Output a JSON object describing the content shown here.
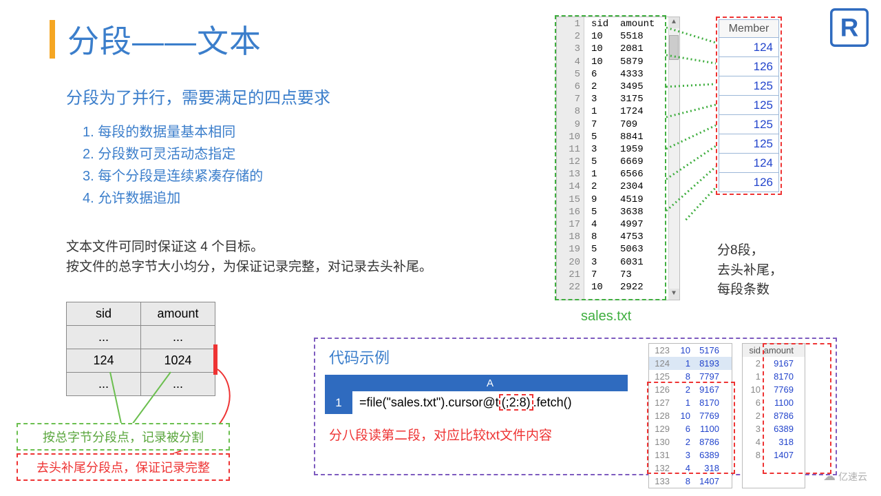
{
  "logo": {
    "letter": "R"
  },
  "watermark": "亿速云",
  "title": "分段——文本",
  "subtitle": "分段为了并行，需要满足的四点要求",
  "requirements": [
    "1. 每段的数据量基本相同",
    "2. 分段数可灵活动态指定",
    "3. 每个分段是连续紧凑存储的",
    "4. 允许数据追加"
  ],
  "body_lines": [
    "文本文件可同时保证这 4 个目标。",
    "按文件的总字节大小均分，为保证记录完整，对记录去头补尾。"
  ],
  "left_table": {
    "headers": [
      "sid",
      "amount"
    ],
    "rows": [
      [
        "...",
        "..."
      ],
      [
        "124",
        "1024"
      ],
      [
        "...",
        "..."
      ]
    ]
  },
  "green_note": "按总字节分段点，记录被分割",
  "red_note": "去头补尾分段点，保证记录完整",
  "code_panel": {
    "title": "代码示例",
    "col_header": "A",
    "row_num": "1",
    "code_prefix": "=file(\"sales.txt\").cursor@t",
    "code_boxed": "(;2:8)",
    "code_suffix": ".fetch()",
    "caption": "分八段读第二段，对应比较txt文件内容"
  },
  "txt_file": {
    "label": "sales.txt",
    "lines": [
      {
        "n": "1",
        "t": "sid  amount"
      },
      {
        "n": "2",
        "t": "10   5518"
      },
      {
        "n": "3",
        "t": "10   2081"
      },
      {
        "n": "4",
        "t": "10   5879"
      },
      {
        "n": "5",
        "t": "6    4333"
      },
      {
        "n": "6",
        "t": "2    3495"
      },
      {
        "n": "7",
        "t": "3    3175"
      },
      {
        "n": "8",
        "t": "1    1724"
      },
      {
        "n": "9",
        "t": "7    709"
      },
      {
        "n": "10",
        "t": "5    8841"
      },
      {
        "n": "11",
        "t": "3    1959"
      },
      {
        "n": "12",
        "t": "5    6669"
      },
      {
        "n": "13",
        "t": "1    6566"
      },
      {
        "n": "14",
        "t": "2    2304"
      },
      {
        "n": "15",
        "t": "9    4519"
      },
      {
        "n": "16",
        "t": "5    3638"
      },
      {
        "n": "17",
        "t": "4    4997"
      },
      {
        "n": "18",
        "t": "8    4753"
      },
      {
        "n": "19",
        "t": "5    5063"
      },
      {
        "n": "20",
        "t": "3    6031"
      },
      {
        "n": "21",
        "t": "7    73"
      },
      {
        "n": "22",
        "t": "10   2922"
      }
    ]
  },
  "member": {
    "header": "Member",
    "values": [
      "124",
      "126",
      "125",
      "125",
      "125",
      "125",
      "124",
      "126"
    ],
    "caption_lines": [
      "分8段，",
      "去头补尾，",
      "每段条数"
    ]
  },
  "mini1": {
    "rows": [
      {
        "n": "123",
        "a": "10",
        "b": "5176"
      },
      {
        "n": "124",
        "a": "1",
        "b": "8193",
        "hl": true
      },
      {
        "n": "125",
        "a": "8",
        "b": "7797"
      },
      {
        "n": "126",
        "a": "2",
        "b": "9167"
      },
      {
        "n": "127",
        "a": "1",
        "b": "8170"
      },
      {
        "n": "128",
        "a": "10",
        "b": "7769"
      },
      {
        "n": "129",
        "a": "6",
        "b": "1100"
      },
      {
        "n": "130",
        "a": "2",
        "b": "8786"
      },
      {
        "n": "131",
        "a": "3",
        "b": "6389"
      },
      {
        "n": "132",
        "a": "4",
        "b": "318"
      },
      {
        "n": "133",
        "a": "8",
        "b": "1407"
      }
    ]
  },
  "mini2": {
    "headers": [
      "sid",
      "amount"
    ],
    "rows": [
      {
        "a": "2",
        "b": "9167"
      },
      {
        "a": "1",
        "b": "8170"
      },
      {
        "a": "10",
        "b": "7769"
      },
      {
        "a": "6",
        "b": "1100"
      },
      {
        "a": "2",
        "b": "8786"
      },
      {
        "a": "3",
        "b": "6389"
      },
      {
        "a": "4",
        "b": "318"
      },
      {
        "a": "8",
        "b": "1407"
      }
    ]
  }
}
